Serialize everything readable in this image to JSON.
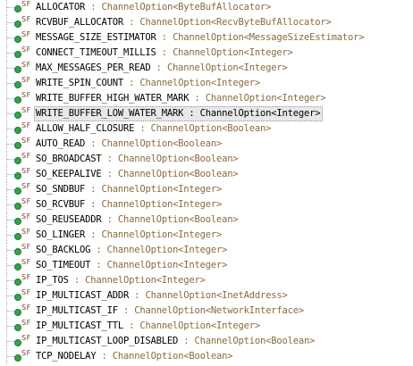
{
  "outline": {
    "icon_name": "static-final-field-icon",
    "badge_text": "SF",
    "separator": " : ",
    "selected_index": 7,
    "items": [
      {
        "name": "ALLOCATOR",
        "type": "ChannelOption<ByteBufAllocator>"
      },
      {
        "name": "RCVBUF_ALLOCATOR",
        "type": "ChannelOption<RecvByteBufAllocator>"
      },
      {
        "name": "MESSAGE_SIZE_ESTIMATOR",
        "type": "ChannelOption<MessageSizeEstimator>"
      },
      {
        "name": "CONNECT_TIMEOUT_MILLIS",
        "type": "ChannelOption<Integer>"
      },
      {
        "name": "MAX_MESSAGES_PER_READ",
        "type": "ChannelOption<Integer>"
      },
      {
        "name": "WRITE_SPIN_COUNT",
        "type": "ChannelOption<Integer>"
      },
      {
        "name": "WRITE_BUFFER_HIGH_WATER_MARK",
        "type": "ChannelOption<Integer>"
      },
      {
        "name": "WRITE_BUFFER_LOW_WATER_MARK",
        "type": "ChannelOption<Integer>"
      },
      {
        "name": "ALLOW_HALF_CLOSURE",
        "type": "ChannelOption<Boolean>"
      },
      {
        "name": "AUTO_READ",
        "type": "ChannelOption<Boolean>"
      },
      {
        "name": "SO_BROADCAST",
        "type": "ChannelOption<Boolean>"
      },
      {
        "name": "SO_KEEPALIVE",
        "type": "ChannelOption<Boolean>"
      },
      {
        "name": "SO_SNDBUF",
        "type": "ChannelOption<Integer>"
      },
      {
        "name": "SO_RCVBUF",
        "type": "ChannelOption<Integer>"
      },
      {
        "name": "SO_REUSEADDR",
        "type": "ChannelOption<Boolean>"
      },
      {
        "name": "SO_LINGER",
        "type": "ChannelOption<Integer>"
      },
      {
        "name": "SO_BACKLOG",
        "type": "ChannelOption<Integer>"
      },
      {
        "name": "SO_TIMEOUT",
        "type": "ChannelOption<Integer>"
      },
      {
        "name": "IP_TOS",
        "type": "ChannelOption<Integer>"
      },
      {
        "name": "IP_MULTICAST_ADDR",
        "type": "ChannelOption<InetAddress>"
      },
      {
        "name": "IP_MULTICAST_IF",
        "type": "ChannelOption<NetworkInterface>"
      },
      {
        "name": "IP_MULTICAST_TTL",
        "type": "ChannelOption<Integer>"
      },
      {
        "name": "IP_MULTICAST_LOOP_DISABLED",
        "type": "ChannelOption<Boolean>"
      },
      {
        "name": "TCP_NODELAY",
        "type": "ChannelOption<Boolean>"
      }
    ]
  }
}
